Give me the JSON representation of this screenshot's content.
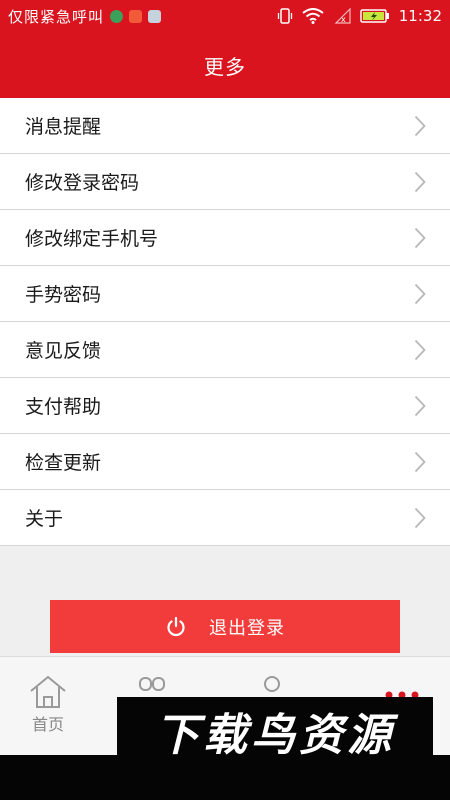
{
  "status_bar": {
    "carrier": "仅限紧急呼叫",
    "time": "11:32",
    "icons": [
      "vibrate-icon",
      "wifi-icon",
      "no-signal-icon",
      "battery-charging-icon"
    ],
    "notification_icons": [
      "green-app-icon",
      "red-app-icon",
      "android-icon"
    ]
  },
  "header": {
    "title": "更多"
  },
  "menu": {
    "items": [
      {
        "label": "消息提醒"
      },
      {
        "label": "修改登录密码"
      },
      {
        "label": "修改绑定手机号"
      },
      {
        "label": "手势密码"
      },
      {
        "label": "意见反馈"
      },
      {
        "label": "支付帮助"
      },
      {
        "label": "检查更新"
      },
      {
        "label": "关于"
      }
    ]
  },
  "logout": {
    "label": "退出登录"
  },
  "bottom_nav": {
    "items": [
      {
        "label": "首页",
        "icon": "home-icon"
      },
      {
        "label": "",
        "icon": "grid-icon"
      },
      {
        "label": "",
        "icon": "user-icon"
      },
      {
        "label": "",
        "icon": "more-dots-icon"
      }
    ]
  },
  "watermark": {
    "text": "下载鸟资源"
  },
  "colors": {
    "brand_red": "#d9141e",
    "logout_red": "#f23c3c",
    "text": "#1a1a1a",
    "divider": "#d6d6d6",
    "nav_gray": "#888888",
    "nav_active": "#d9141e"
  }
}
